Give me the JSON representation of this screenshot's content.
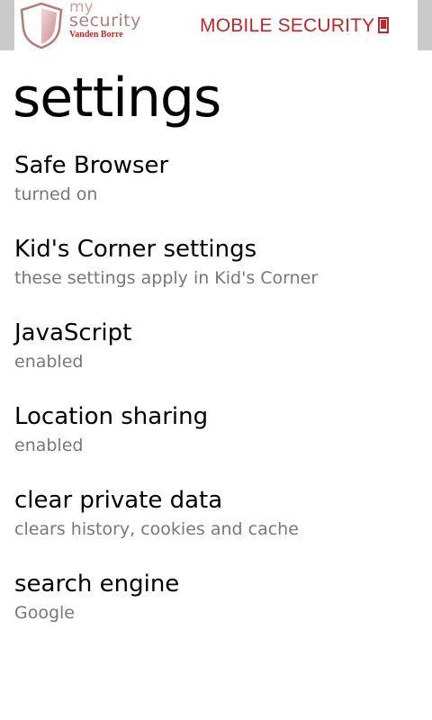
{
  "header": {
    "logo_my": "my",
    "logo_security": "security",
    "logo_brand": "Vanden Borre",
    "title": "MOBILE SECURITY",
    "phone_icon": "phone-icon"
  },
  "page": {
    "title": "settings"
  },
  "settings": [
    {
      "label": "Safe Browser",
      "sub": "turned on"
    },
    {
      "label": "Kid's Corner settings",
      "sub": "these settings apply in Kid's Corner"
    },
    {
      "label": "JavaScript",
      "sub": "enabled"
    },
    {
      "label": "Location sharing",
      "sub": "enabled"
    },
    {
      "label": "clear private data",
      "sub": "clears history, cookies and cache"
    },
    {
      "label": "search engine",
      "sub": "Google"
    }
  ],
  "colors": {
    "brand_red": "#c0272d",
    "logo_pink": "#b67a7a",
    "subtext_gray": "#777777",
    "edge_gray": "#c9c9c9"
  }
}
